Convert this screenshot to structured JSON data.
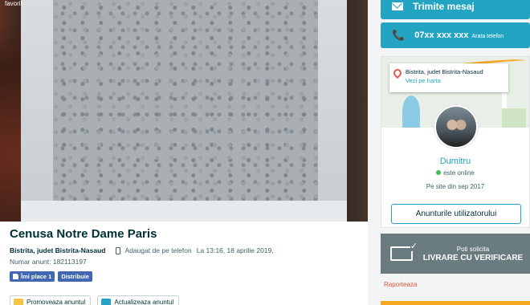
{
  "listing": {
    "photo_badge": "favorit",
    "title": "Cenusa Notre Dame Paris",
    "location": "Bistrita, judet Bistrita-Nasaud",
    "added_from": "Adaugat de pe telefon",
    "posted": "La 13:16, 18 aprilie 2019,",
    "ad_number": "Numar anunt: 182113197",
    "facebook": {
      "like": "Îmi place 1",
      "share": "Distribuie"
    },
    "actions": {
      "promote": "Promoveaza anuntul",
      "refresh": "Actualizeaza anuntul"
    }
  },
  "sidebar": {
    "send_message": "Trimite mesaj",
    "phone": "07xx xxx xxx",
    "show_phone": "Arata telefon",
    "map": {
      "location": "Bistrita, judet Bistrita-Nasaud",
      "view_map": "Vezi pe harta"
    },
    "seller": {
      "name": "Dumitru",
      "status": "este online",
      "since": "Pe site din sep 2017",
      "ads_button": "Anunturile utilizatorului"
    },
    "delivery": {
      "line1": "Poti solicita",
      "line2": "LIVRARE CU VERIFICARE"
    },
    "report": "Raporteaza"
  },
  "colors": {
    "accent": "#23a4c3",
    "dark": "#002f34",
    "facebook": "#4267b2",
    "online": "#3dc05a",
    "report": "#e0533b"
  }
}
